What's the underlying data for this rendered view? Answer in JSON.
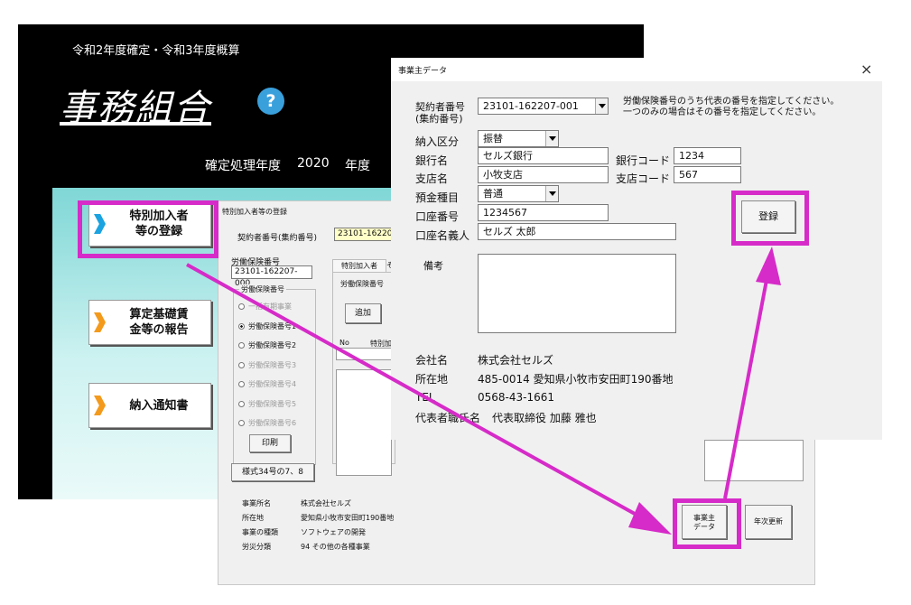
{
  "main": {
    "subtitle": "令和2年度確定・令和3年度概算",
    "title": "事務組合",
    "help_symbol": "?",
    "year_label": "確定処理年度",
    "year_value": "2020",
    "year_unit": "年度",
    "menu": [
      {
        "label": "特別加入者\n等の登録",
        "chevron_color": "#1aa3e0"
      },
      {
        "label": "算定基礎賃\n金等の報告",
        "chevron_color": "#f39a1c"
      },
      {
        "label": "納入通知書",
        "chevron_color": "#f39a1c"
      }
    ]
  },
  "registration": {
    "title": "特別加入者等の登録",
    "contractor_label": "契約者番号(集約番号)",
    "contractor_value": "23101-16220",
    "insurance_label": "労働保険番号",
    "insurance_value": "23101-162207-000",
    "group_label": "労働保険番号",
    "radio_options": [
      {
        "label": "一括有期事業",
        "checked": false,
        "enabled": false
      },
      {
        "label": "労働保険番号1",
        "checked": true,
        "enabled": true
      },
      {
        "label": "労働保険番号2",
        "checked": false,
        "enabled": true
      },
      {
        "label": "労働保険番号3",
        "checked": false,
        "enabled": false
      },
      {
        "label": "労働保険番号4",
        "checked": false,
        "enabled": false
      },
      {
        "label": "労働保険番号5",
        "checked": false,
        "enabled": false
      },
      {
        "label": "労働保険番号6",
        "checked": false,
        "enabled": false
      }
    ],
    "print_button": "印刷",
    "form_button": "様式34号の7、8",
    "tab_label": "特別加入者",
    "tab2_label": "そ",
    "tab_field_label": "労働保険番号",
    "add_button": "追加",
    "col_no": "No",
    "col_name": "特別加",
    "info": [
      {
        "label": "事業所名",
        "value": "株式会社セルズ"
      },
      {
        "label": "所在地",
        "value": "愛知県小牧市安田町190番地"
      },
      {
        "label": "事業の種類",
        "value": "ソフトウェアの開発"
      },
      {
        "label": "労災分類",
        "value": "94 その他の各種事業"
      }
    ],
    "employer_button": "事業主\nデータ",
    "annual_button": "年次更新"
  },
  "employer": {
    "title": "事業主データ",
    "close_symbol": "×",
    "contract_label": "契約者番号\n(集約番号)",
    "contract_value": "23101-162207-001",
    "hint_line1": "労働保険番号のうち代表の番号を指定してください。",
    "hint_line2": "一つのみの場合はその番号を指定してください。",
    "payment_label": "納入区分",
    "payment_value": "振替",
    "bank_label": "銀行名",
    "bank_value": "セルズ銀行",
    "bank_code_label": "銀行コード",
    "bank_code_value": "1234",
    "branch_label": "支店名",
    "branch_value": "小牧支店",
    "branch_code_label": "支店コード",
    "branch_code_value": "567",
    "deposit_label": "預金種目",
    "deposit_value": "普通",
    "account_no_label": "口座番号",
    "account_no_value": "1234567",
    "account_name_label": "口座名義人",
    "account_name_value": "セルズ 太郎",
    "register_button": "登録",
    "memo_label": "備考",
    "company_label": "会社名",
    "company_value": "株式会社セルズ",
    "address_label": "所在地",
    "address_value": "485-0014  愛知県小牧市安田町190番地",
    "tel_label": "TEL",
    "tel_value": "0568-43-1661",
    "rep_label": "代表者職氏名",
    "rep_value": "代表取締役  加藤  雅也"
  },
  "colors": {
    "highlight": "#d62bc8"
  }
}
